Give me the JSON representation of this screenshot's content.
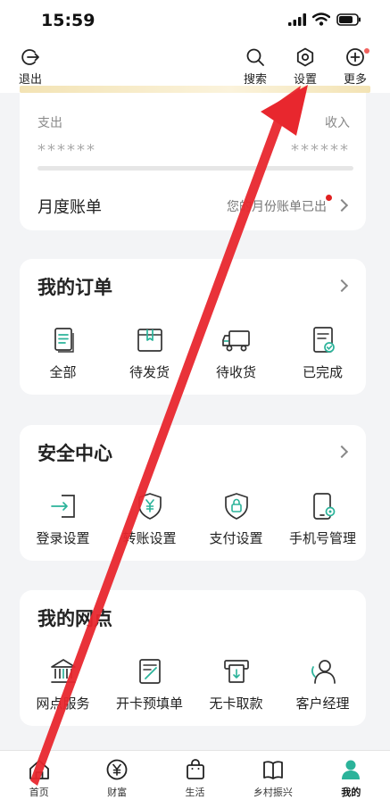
{
  "status_bar": {
    "time": "15:59"
  },
  "top_bar": {
    "logout": "退出",
    "search": "搜索",
    "settings": "设置",
    "more": "更多"
  },
  "asset": {
    "expense_label": "支出",
    "income_label": "收入",
    "expense_value": "******",
    "income_value": "******",
    "monthly_bill_title": "月度账单",
    "monthly_bill_note": "您的月份账单已出"
  },
  "orders": {
    "title": "我的订单",
    "items": [
      {
        "label": "全部",
        "icon": "document-icon"
      },
      {
        "label": "待发货",
        "icon": "box-icon"
      },
      {
        "label": "待收货",
        "icon": "truck-icon"
      },
      {
        "label": "已完成",
        "icon": "completed-doc-icon"
      }
    ]
  },
  "security": {
    "title": "安全中心",
    "items": [
      {
        "label": "登录设置",
        "icon": "login-icon"
      },
      {
        "label": "转账设置",
        "icon": "shield-yen-icon"
      },
      {
        "label": "支付设置",
        "icon": "shield-lock-icon"
      },
      {
        "label": "手机号管理",
        "icon": "phone-gear-icon"
      }
    ]
  },
  "branch": {
    "title": "我的网点",
    "items": [
      {
        "label": "网点服务",
        "icon": "bank-icon"
      },
      {
        "label": "开卡预填单",
        "icon": "form-edit-icon"
      },
      {
        "label": "无卡取款",
        "icon": "atm-icon"
      },
      {
        "label": "客户经理",
        "icon": "manager-icon"
      }
    ]
  },
  "tabs": [
    {
      "label": "首页",
      "icon": "home-icon"
    },
    {
      "label": "财富",
      "icon": "yen-coin-icon"
    },
    {
      "label": "生活",
      "icon": "shopping-bag-icon"
    },
    {
      "label": "乡村振兴",
      "icon": "book-icon"
    },
    {
      "label": "我的",
      "icon": "profile-icon"
    }
  ],
  "colors": {
    "accent": "#2bb39a",
    "arrow": "#e8272e",
    "text": "#222222"
  }
}
